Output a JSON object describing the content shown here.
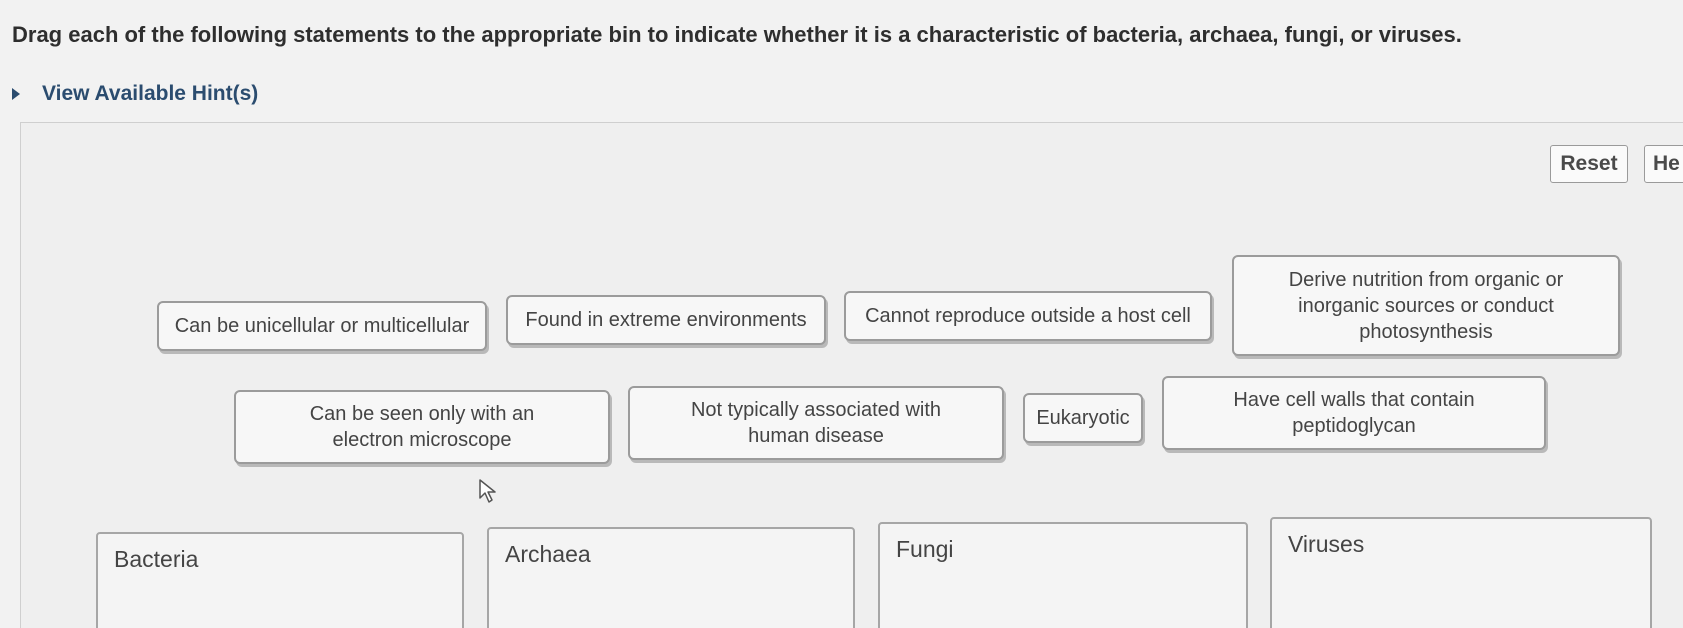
{
  "instruction": "Drag each of the following statements to the appropriate bin to indicate whether it is a characteristic of bacteria, archaea, fungi, or viruses.",
  "hint": {
    "label": "View Available Hint(s)",
    "icon": "caret-right-icon"
  },
  "toolbar": {
    "reset_label": "Reset",
    "help_label": "He"
  },
  "labels": [
    "Can be unicellular or multicellular",
    "Found in extreme environments",
    "Cannot reproduce outside a host cell",
    "Derive nutrition from organic or inorganic sources or conduct photosynthesis",
    "Can be seen only with an electron microscope",
    "Not typically associated with human disease",
    "Eukaryotic",
    "Have cell walls that contain peptidoglycan"
  ],
  "bins": [
    "Bacteria",
    "Archaea",
    "Fungi",
    "Viruses"
  ]
}
